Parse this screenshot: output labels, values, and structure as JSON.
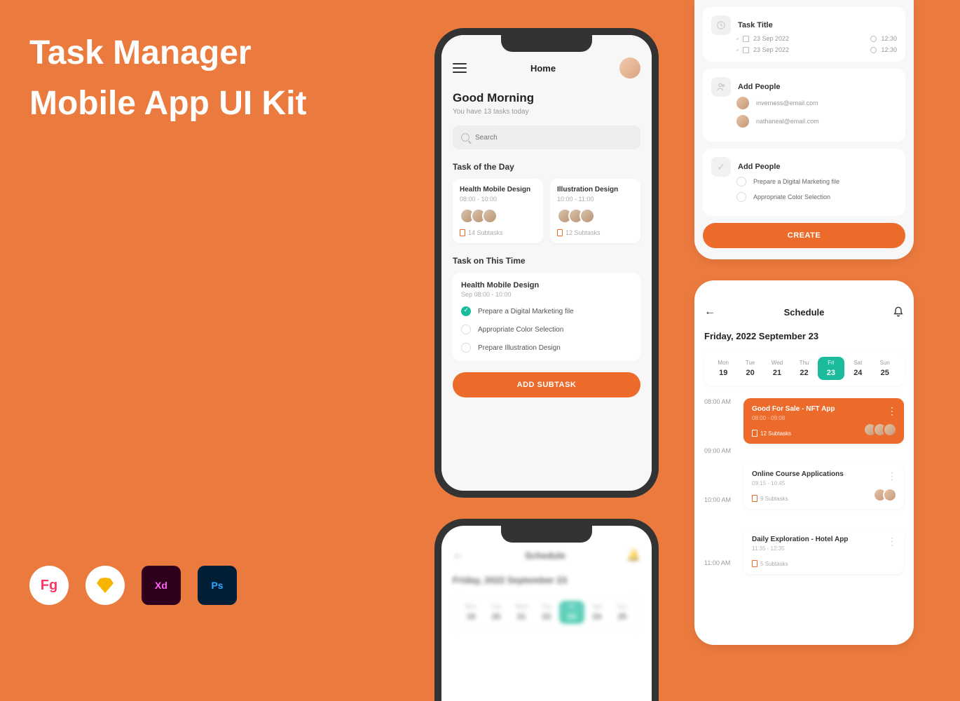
{
  "marketing": {
    "line1": "Task Manager",
    "line2": "Mobile App UI Kit",
    "tools": [
      "Fg",
      "Sk",
      "Xd",
      "Ps"
    ]
  },
  "home": {
    "title": "Home",
    "greeting": "Good Morning",
    "tasks_sub": "You have 13 tasks today",
    "search_placeholder": "Search",
    "sec_day": "Task of the Day",
    "cards": [
      {
        "title": "Health Mobile Design",
        "time": "08:00 - 10:00",
        "sub": "14 Subtasks"
      },
      {
        "title": "Illustration Design",
        "time": "10:00 - 11:00",
        "sub": "12 Subtasks"
      }
    ],
    "sec_time": "Task on This Time",
    "timeTask": {
      "title": "Health Mobile Design",
      "sub": "Sep 08:00 - 10:00"
    },
    "subtasks": [
      {
        "label": "Prepare a Digital Marketing file",
        "done": true
      },
      {
        "label": "Appropriate Color Selection",
        "done": false
      },
      {
        "label": "Prepare Illustration Design",
        "done": false
      }
    ],
    "add_btn": "ADD SUBTASK"
  },
  "create": {
    "task_title_label": "Task Title",
    "dates": [
      {
        "date": "23 Sep 2022",
        "time": "12:30"
      },
      {
        "date": "23 Sep 2022",
        "time": "12:30"
      }
    ],
    "people_label": "Add People",
    "emails": [
      "inverness@email.com",
      "nathaneal@email.com"
    ],
    "subtasks_label": "Add People",
    "subtasks": [
      "Prepare a Digital Marketing file",
      "Appropriate Color Selection"
    ],
    "btn": "CREATE"
  },
  "schedule": {
    "title": "Schedule",
    "date_title": "Friday, 2022 September 23",
    "days": [
      {
        "name": "Mon",
        "num": "19"
      },
      {
        "name": "Tue",
        "num": "20"
      },
      {
        "name": "Wed",
        "num": "21"
      },
      {
        "name": "Thu",
        "num": "22"
      },
      {
        "name": "Fri",
        "num": "23",
        "active": true
      },
      {
        "name": "Sat",
        "num": "24"
      },
      {
        "name": "Sun",
        "num": "25"
      }
    ],
    "times": [
      "08:00 AM",
      "09:00 AM",
      "10:00 AM",
      "11:00 AM"
    ],
    "events": [
      {
        "title": "Good For Sale - NFT App",
        "time": "08:00 - 09:08",
        "sub": "12 Subtasks",
        "orange": true
      },
      {
        "title": "Online Course Applications",
        "time": "09:15 - 10:45",
        "sub": "9 Subtasks",
        "orange": false
      },
      {
        "title": "Daily Exploration - Hotel App",
        "time": "11:35 - 12:35",
        "sub": "5 Subtasks",
        "orange": false
      }
    ]
  },
  "blurred": {
    "title": "Schedule",
    "date": "Friday, 2022 September 23"
  }
}
